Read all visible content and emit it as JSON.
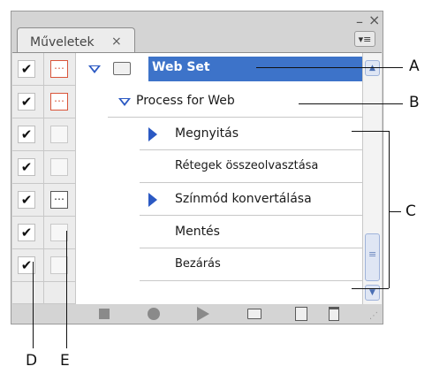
{
  "panel": {
    "tab_label": "Műveletek",
    "tab_close": "×",
    "window_minimize": "–",
    "window_close": "×",
    "panel_menu_glyph": "▾≡"
  },
  "rows": [
    {
      "label": "Web Set",
      "checked": true,
      "dialog": "red",
      "type": "set",
      "selected": true
    },
    {
      "label": "Process for Web",
      "checked": true,
      "dialog": "red",
      "type": "action"
    },
    {
      "label": "Megnyitás",
      "checked": true,
      "dialog": "none",
      "type": "command",
      "expandable": true
    },
    {
      "label": "Rétegek összeolvasztása",
      "checked": true,
      "dialog": "none",
      "type": "command"
    },
    {
      "label": "Színmód konvertálása",
      "checked": true,
      "dialog": "black",
      "type": "command",
      "expandable": true
    },
    {
      "label": "Mentés",
      "checked": true,
      "dialog": "none",
      "type": "command"
    },
    {
      "label": "Bezárás",
      "checked": true,
      "dialog": "none",
      "type": "command"
    }
  ],
  "check_glyph": "✔",
  "callouts": {
    "a": "A",
    "b": "B",
    "c": "C",
    "d": "D",
    "e": "E"
  },
  "icons": [
    "stop-icon",
    "record-icon",
    "play-icon",
    "new-set-folder-icon",
    "new-action-icon",
    "trash-icon",
    "resize-grip-icon"
  ],
  "colors": {
    "selection": "#3d73c9",
    "expand_triangle": "#2b59c3",
    "dialog_red": "#d9553a"
  }
}
